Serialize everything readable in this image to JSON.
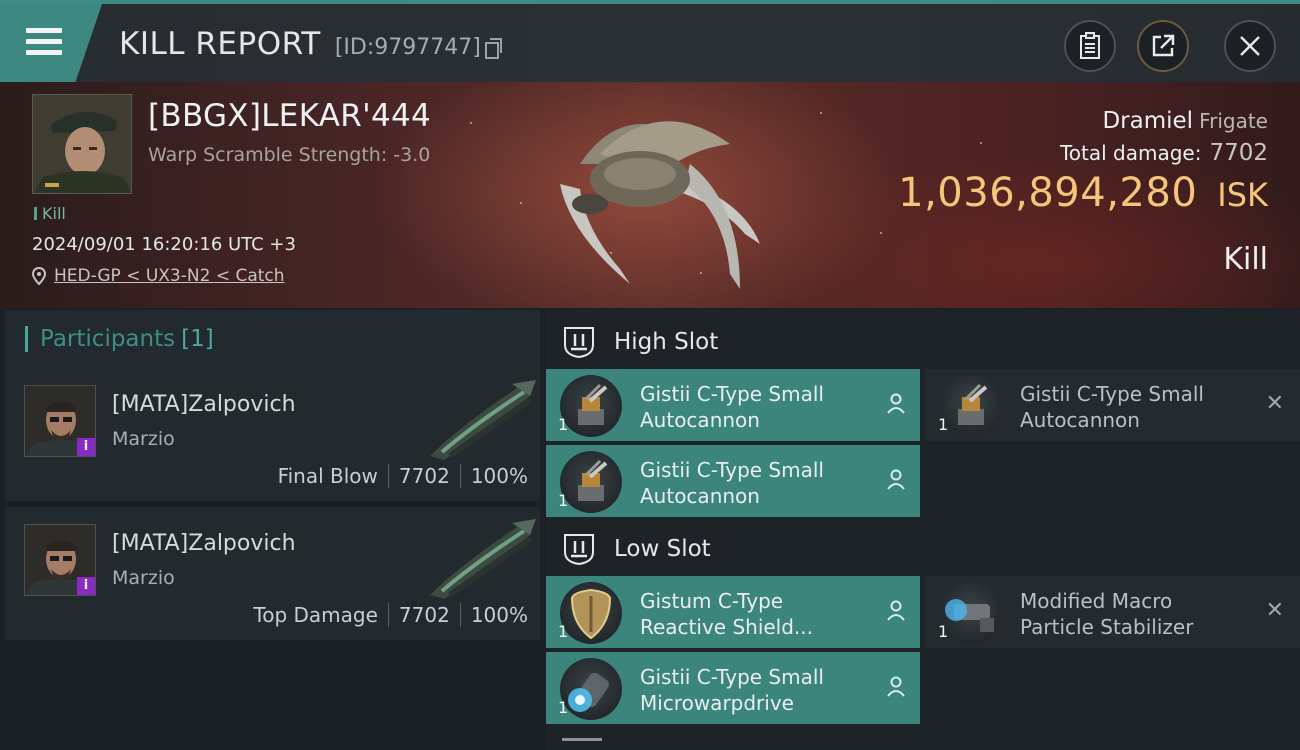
{
  "header": {
    "title": "KILL REPORT",
    "report_id": "[ID:9797747]",
    "icons": [
      "menu-icon",
      "copy-icon",
      "clipboard-icon",
      "share-icon",
      "close-icon"
    ]
  },
  "victim": {
    "name": "[BBGX]LEKAR'444",
    "scramble": "Warp Scramble Strength: -3.0",
    "kill_count": "Kill",
    "timestamp": "2024/09/01 16:20:16 UTC +3",
    "location": "HED-GP < UX3-N2 < Catch",
    "ship_name": "Dramiel",
    "ship_class": "Frigate",
    "total_damage_label": "Total damage:",
    "total_damage": "7702",
    "isk_value": "1,036,894,280",
    "isk_unit": "ISK",
    "report_type": "Kill"
  },
  "participants": {
    "label": "Participants",
    "count": "[1]",
    "rows": [
      {
        "name": "[MATA]Zalpovich",
        "sub": "Marzio",
        "badge": "i",
        "role": "Final Blow",
        "damage": "7702",
        "percent": "100%"
      },
      {
        "name": "[MATA]Zalpovich",
        "sub": "Marzio",
        "badge": "i",
        "role": "Top Damage",
        "damage": "7702",
        "percent": "100%"
      }
    ]
  },
  "fitting": {
    "high_slot": {
      "label": "High Slot",
      "modules": [
        {
          "name": "Gistii C-Type Small Autocannon",
          "qty": "1",
          "state": "fitted"
        },
        {
          "name": "Gistii C-Type Small Autocannon",
          "qty": "1",
          "state": "dropped"
        },
        {
          "name": "Gistii C-Type Small Autocannon",
          "qty": "1",
          "state": "fitted"
        }
      ]
    },
    "low_slot": {
      "label": "Low Slot",
      "modules": [
        {
          "name": "Gistum C-Type Reactive Shield...",
          "qty": "1",
          "state": "fitted"
        },
        {
          "name": "Modified Macro Particle Stabilizer",
          "qty": "1",
          "state": "dropped"
        },
        {
          "name": "Gistii C-Type Small Microwarpdrive",
          "qty": "1",
          "state": "fitted"
        }
      ]
    }
  },
  "colors": {
    "accent": "#3d8982",
    "fitted": "#3c857d",
    "isk": "#f4c57a",
    "badge": "#8a2ac4"
  }
}
